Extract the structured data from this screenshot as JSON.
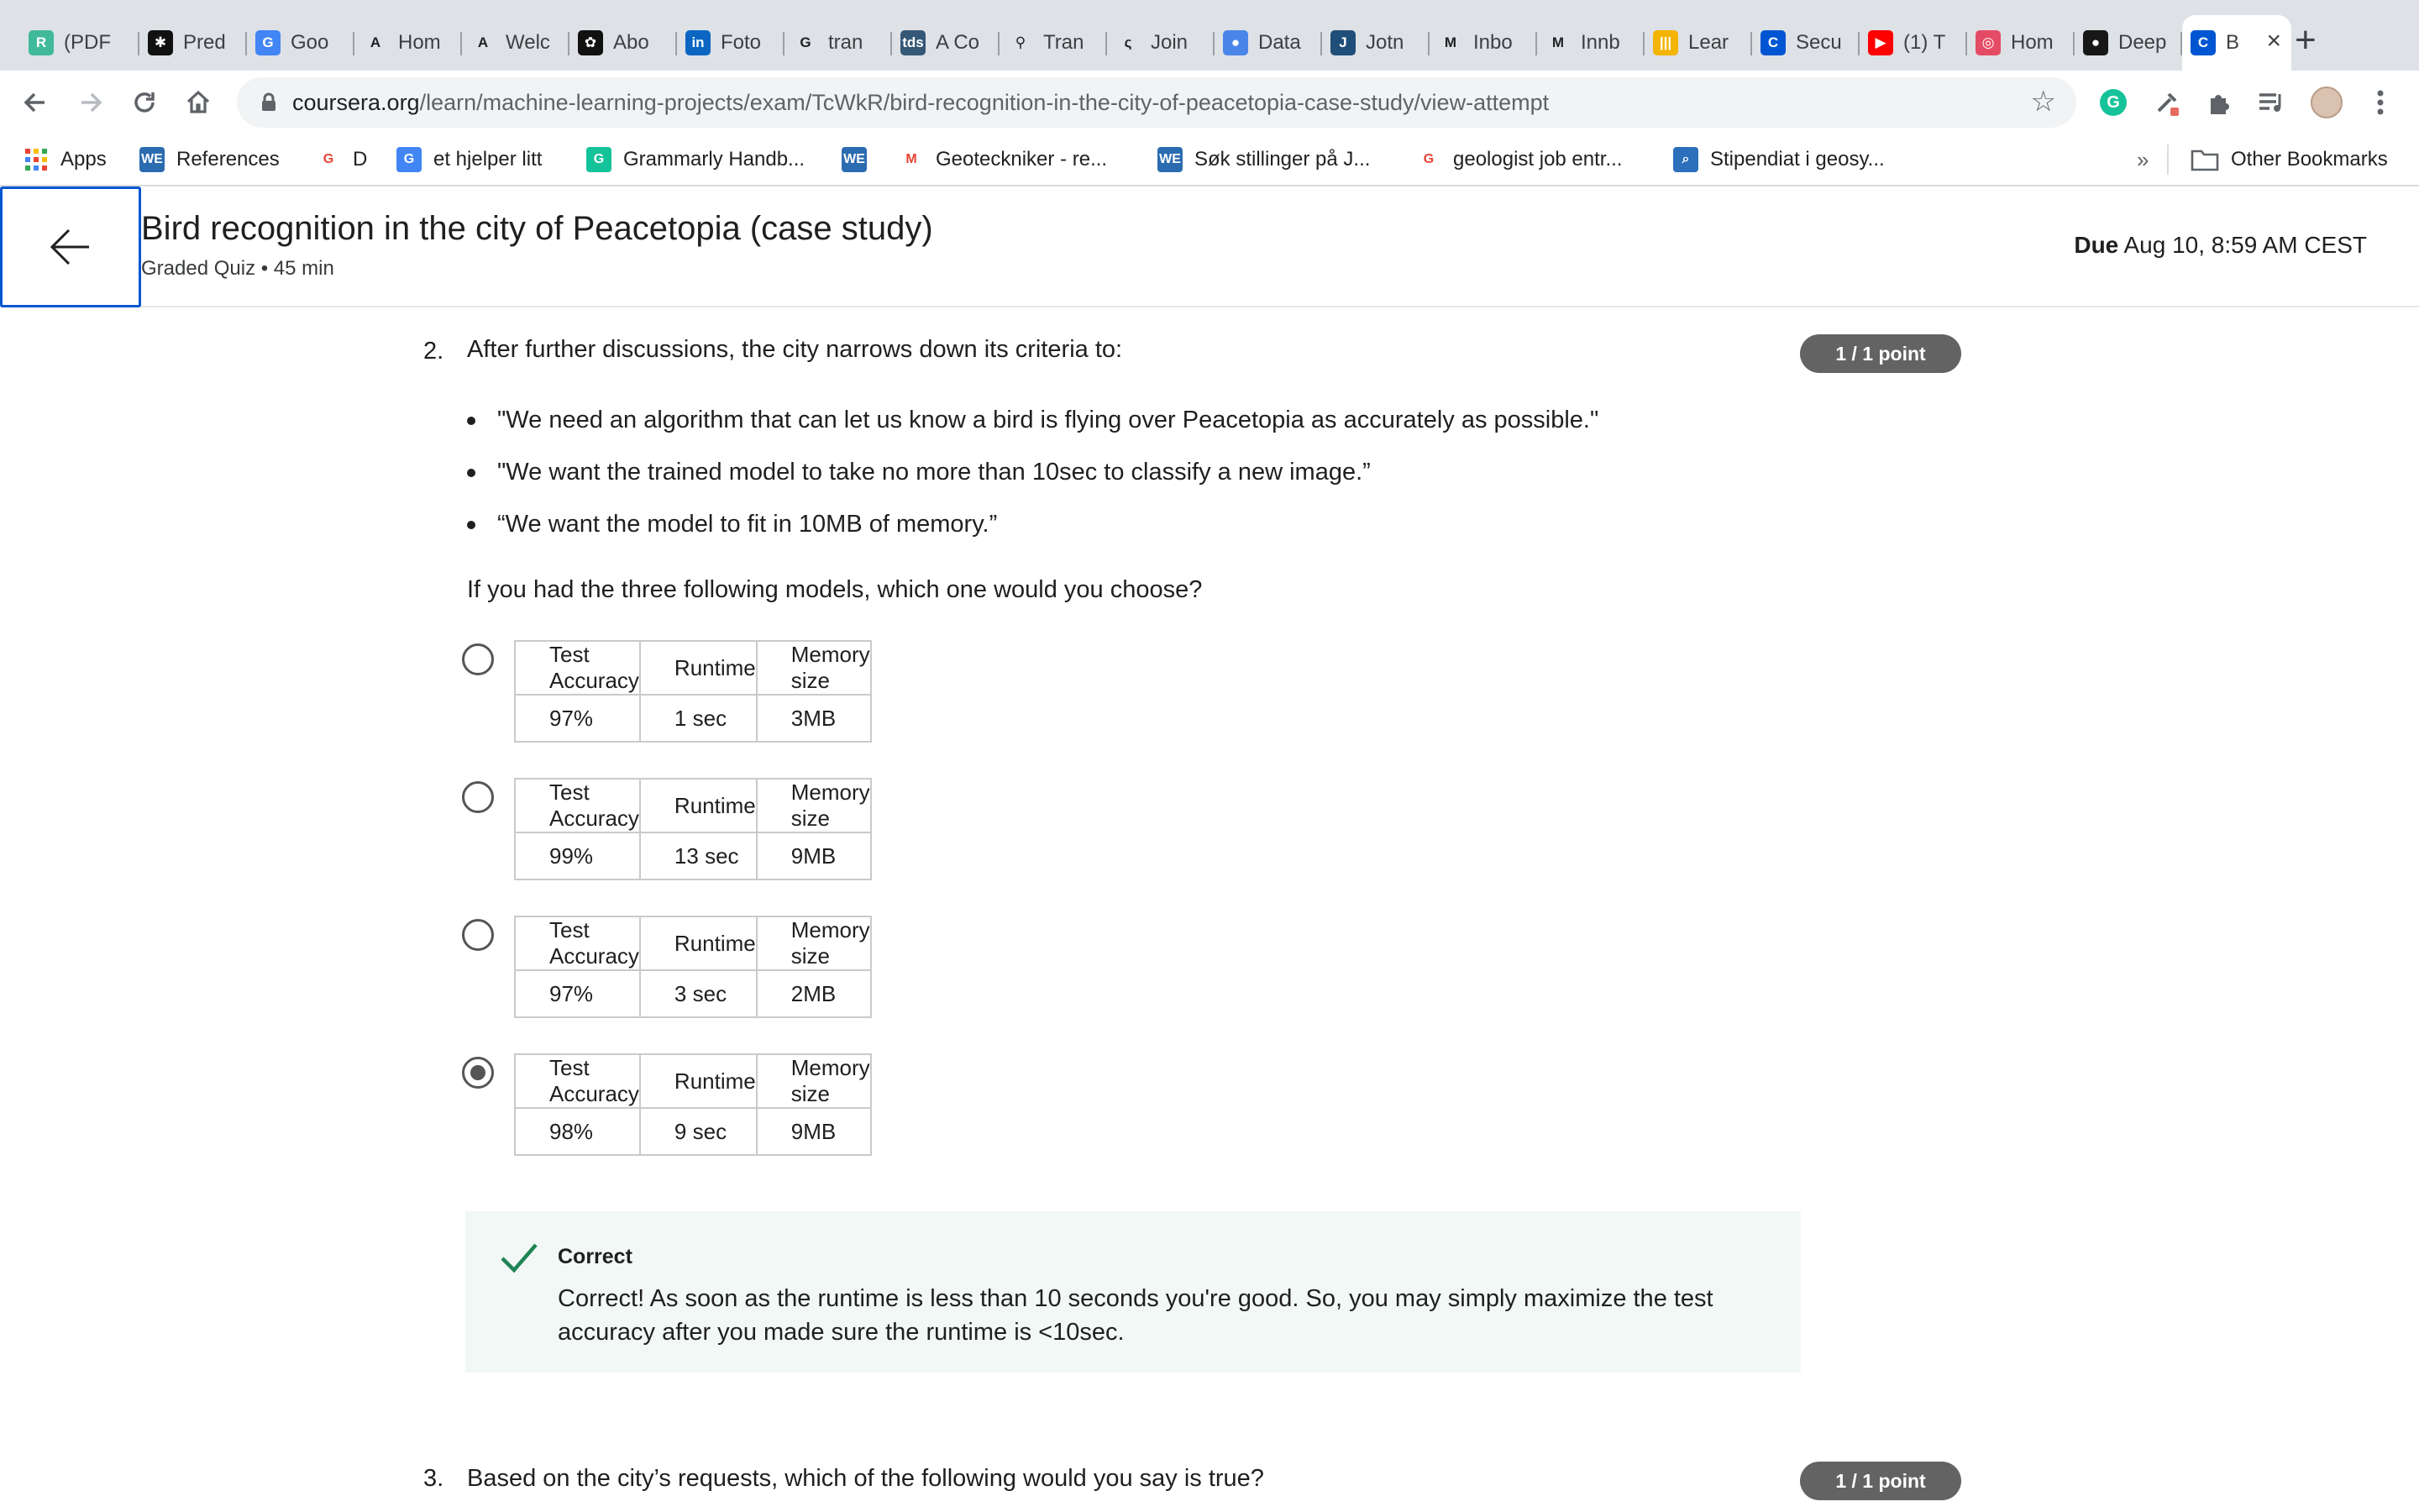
{
  "browser": {
    "tabs": [
      {
        "icon_name": "researchgate-icon",
        "icon_glyph": "R",
        "color": "#40ba9b",
        "title": "(PDF"
      },
      {
        "icon_name": "gear-icon",
        "icon_glyph": "✱",
        "color": "#111111",
        "title": "Pred"
      },
      {
        "icon_name": "google-translate-icon",
        "icon_glyph": "G",
        "color": "#4285f4",
        "title": "Goo"
      },
      {
        "icon_name": "letter-a-icon",
        "icon_glyph": "A",
        "color": "#ffffff",
        "title": "Hom"
      },
      {
        "icon_name": "letter-a-icon",
        "icon_glyph": "A",
        "color": "#ffffff",
        "title": "Welc"
      },
      {
        "icon_name": "openai-icon",
        "icon_glyph": "✿",
        "color": "#111111",
        "title": "Abo"
      },
      {
        "icon_name": "linkedin-icon",
        "icon_glyph": "in",
        "color": "#0a66c2",
        "title": "Foto"
      },
      {
        "icon_name": "google-icon",
        "icon_glyph": "G",
        "color": "#ffffff",
        "title": "tran"
      },
      {
        "icon_name": "tds-icon",
        "icon_glyph": "tds",
        "color": "#355876",
        "title": "A Co"
      },
      {
        "icon_name": "bicycle-icon",
        "icon_glyph": "⚲",
        "color": "#ffffff",
        "title": "Tran"
      },
      {
        "icon_name": "link-icon",
        "icon_glyph": "ς",
        "color": "#ffffff",
        "title": "Join"
      },
      {
        "icon_name": "drop-icon",
        "icon_glyph": "●",
        "color": "#4a86e8",
        "title": "Data"
      },
      {
        "icon_name": "letter-j-icon",
        "icon_glyph": "J",
        "color": "#1f4e79",
        "title": "Jotn"
      },
      {
        "icon_name": "gmail-icon",
        "icon_glyph": "M",
        "color": "#ffffff",
        "title": "Inbo"
      },
      {
        "icon_name": "gmail-icon",
        "icon_glyph": "M",
        "color": "#ffffff",
        "title": "Innb"
      },
      {
        "icon_name": "bars-icon",
        "icon_glyph": "|||",
        "color": "#f4b400",
        "title": "Lear"
      },
      {
        "icon_name": "coursera-icon",
        "icon_glyph": "C",
        "color": "#0056d2",
        "title": "Secu"
      },
      {
        "icon_name": "youtube-icon",
        "icon_glyph": "▶",
        "color": "#ff0000",
        "title": "(1) T"
      },
      {
        "icon_name": "target-icon",
        "icon_glyph": "◎",
        "color": "#e44c65",
        "title": "Hom"
      },
      {
        "icon_name": "github-icon",
        "icon_glyph": "●",
        "color": "#181717",
        "title": "Deep"
      },
      {
        "icon_name": "coursera-icon",
        "icon_glyph": "C",
        "color": "#0056d2",
        "title": "B",
        "active": true
      }
    ],
    "new_tab_label": "+",
    "close_label": "×",
    "url_host": "coursera.org",
    "url_path": "/learn/machine-learning-projects/exam/TcWkR/bird-recognition-in-the-city-of-peacetopia-case-study/view-attempt",
    "bookmarks": [
      {
        "label": "Apps",
        "icon_name": "apps-grid-icon",
        "icon_glyph": "",
        "color": "#ffffff"
      },
      {
        "label": "References",
        "icon_name": "we-icon",
        "icon_glyph": "WE",
        "color": "#2b6cb0"
      },
      {
        "label": "D",
        "icon_name": "google-icon",
        "icon_glyph": "G",
        "color": "#ffffff"
      },
      {
        "label": "et hjelper litt",
        "icon_name": "google-translate-icon",
        "icon_glyph": "G",
        "color": "#4285f4"
      },
      {
        "label": "Grammarly Handb...",
        "icon_name": "grammarly-icon",
        "icon_glyph": "G",
        "color": "#15c39a"
      },
      {
        "label": "",
        "icon_name": "we-icon",
        "icon_glyph": "WE",
        "color": "#2b6cb0"
      },
      {
        "label": "Geoteckniker - re...",
        "icon_name": "gmail-icon",
        "icon_glyph": "M",
        "color": "#ffffff"
      },
      {
        "label": "Søk stillinger på J...",
        "icon_name": "we-icon",
        "icon_glyph": "WE",
        "color": "#2b6cb0"
      },
      {
        "label": "geologist job entr...",
        "icon_name": "google-icon",
        "icon_glyph": "G",
        "color": "#ffffff"
      },
      {
        "label": "Stipendiat i geosy...",
        "icon_name": "search-square-icon",
        "icon_glyph": "⌕",
        "color": "#2c6fbb"
      }
    ],
    "more_bookmarks_label": "»",
    "other_bookmarks_label": "Other Bookmarks"
  },
  "header": {
    "title": "Bird recognition in the city of Peacetopia (case study)",
    "meta": "Graded Quiz • 45 min",
    "due_label": "Due",
    "due_value": "Aug 10, 8:59 AM CEST"
  },
  "question2": {
    "number": "2.",
    "prompt": "After further discussions, the city narrows down its criteria to:",
    "points": "1 / 1 point",
    "bullets": [
      "\"We need an algorithm that can let us know a bird is flying over Peacetopia as accurately as possible.\"",
      "\"We want the trained model to take no more than 10sec to classify a new image.”",
      "“We want the model to fit in 10MB of memory.”"
    ],
    "ask": "If you had the three following models, which one would you choose?",
    "headers": [
      "Test Accuracy",
      "Runtime",
      "Memory size"
    ],
    "options": [
      {
        "accuracy": "97%",
        "runtime": "1 sec",
        "memory": "3MB",
        "selected": false
      },
      {
        "accuracy": "99%",
        "runtime": "13 sec",
        "memory": "9MB",
        "selected": false
      },
      {
        "accuracy": "97%",
        "runtime": "3 sec",
        "memory": "2MB",
        "selected": false
      },
      {
        "accuracy": "98%",
        "runtime": "9 sec",
        "memory": "9MB",
        "selected": true
      }
    ],
    "feedback": {
      "label": "Correct",
      "text": "Correct! As soon as the runtime is less than 10 seconds you're good. So, you may simply maximize the test accuracy after you made sure the runtime is <10sec.",
      "color": "#1f8354"
    }
  },
  "question3": {
    "number": "3.",
    "prompt": "Based on the city’s requests, which of the following would you say is true?",
    "points": "1 / 1 point"
  }
}
